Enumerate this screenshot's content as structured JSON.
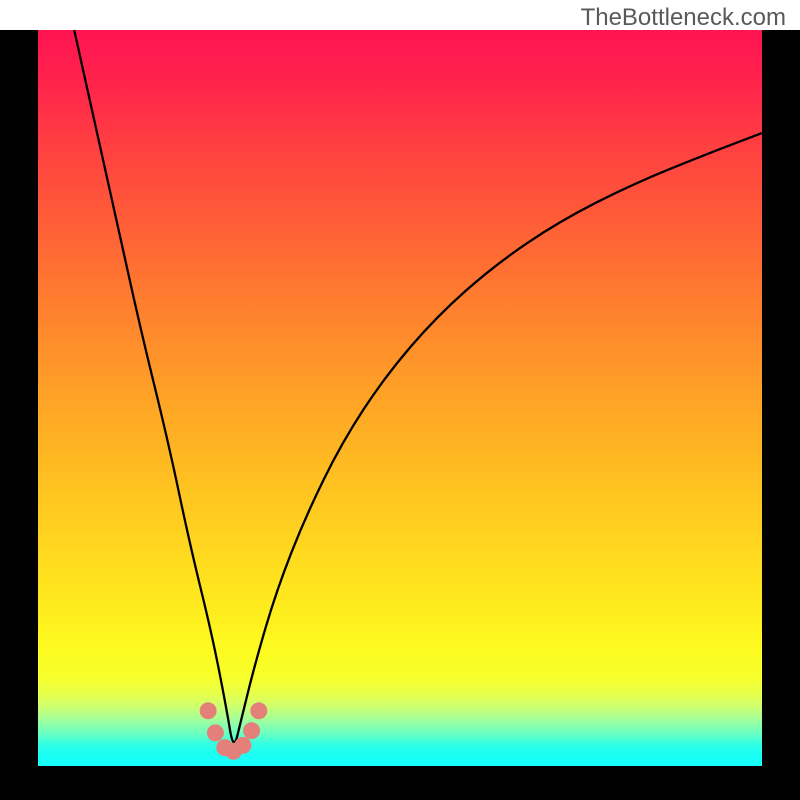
{
  "watermark": "TheBottleneck.com",
  "chart_data": {
    "type": "line",
    "title": "",
    "xlabel": "",
    "ylabel": "",
    "xlim": [
      0,
      100
    ],
    "ylim": [
      0,
      100
    ],
    "notes": "V-shaped bottleneck curve on a vertical gradient from red (top, high bottleneck) to green (bottom, low bottleneck). Minimum of the curve (optimal point) sits near x≈27 at the bottom. A small cluster of salmon-colored markers surrounds the minimum.",
    "series": [
      {
        "name": "bottleneck-curve",
        "x": [
          5,
          10,
          14,
          18,
          21,
          24,
          26,
          27,
          28,
          30,
          33,
          37,
          42,
          48,
          55,
          63,
          72,
          82,
          92,
          100
        ],
        "y": [
          100,
          78,
          60,
          44,
          30,
          18,
          8,
          2,
          6,
          14,
          24,
          34,
          44,
          53,
          61,
          68,
          74,
          79,
          83,
          86
        ]
      }
    ],
    "markers": {
      "name": "optimal-cluster",
      "points": [
        {
          "x": 23.5,
          "y": 7.5
        },
        {
          "x": 24.5,
          "y": 4.5
        },
        {
          "x": 25.8,
          "y": 2.5
        },
        {
          "x": 27.0,
          "y": 2.0
        },
        {
          "x": 28.3,
          "y": 2.8
        },
        {
          "x": 29.5,
          "y": 4.8
        },
        {
          "x": 30.5,
          "y": 7.5
        }
      ]
    }
  }
}
